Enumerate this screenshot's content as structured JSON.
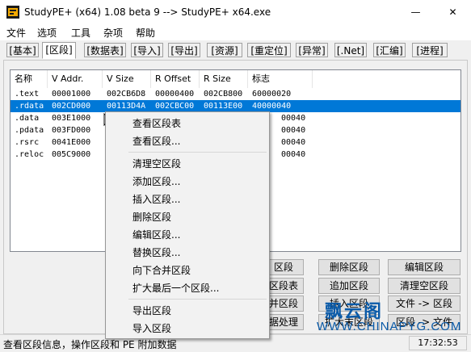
{
  "window": {
    "title": "StudyPE+ (x64) 1.08 beta 9  --> StudyPE+ x64.exe",
    "minimize": "—",
    "close": "✕"
  },
  "menu": [
    "文件",
    "选项",
    "工具",
    "杂项",
    "帮助"
  ],
  "tabs": [
    "[基本]",
    "[区段]",
    "[数据表]",
    "[导入]",
    "[导出]",
    "[资源]",
    "[重定位]",
    "[异常]",
    "[.Net]",
    "[汇编]",
    "[进程]"
  ],
  "table": {
    "headers": [
      "名称",
      "V Addr.",
      "V Size",
      "R Offset",
      "R Size",
      "标志"
    ],
    "rows": [
      [
        ".text",
        "00001000",
        "002CB6D8",
        "00000400",
        "002CB800",
        "60000020"
      ],
      [
        ".rdata",
        "002CD000",
        "00113D4A",
        "002CBC00",
        "00113E00",
        "40000040"
      ],
      [
        ".data",
        "003E1000",
        "",
        "",
        "",
        "00040"
      ],
      [
        ".pdata",
        "003FD000",
        "",
        "",
        "",
        "00040"
      ],
      [
        ".rsrc",
        "0041E000",
        "",
        "",
        "",
        "00040"
      ],
      [
        ".reloc",
        "005C9000",
        "",
        "",
        "",
        "00040"
      ]
    ]
  },
  "context_menu": {
    "group1": [
      "查看区段表",
      "查看区段..."
    ],
    "group2": [
      "清理空区段",
      "添加区段...",
      "插入区段...",
      "删除区段",
      "编辑区段...",
      "替换区段...",
      "向下合并区段",
      "扩大最后一个区段..."
    ],
    "group3": [
      "导出区段",
      "导入区段"
    ]
  },
  "buttons": {
    "row1": [
      "区段",
      "删除区段",
      "编辑区段"
    ],
    "row2": [
      "区段表",
      "追加区段",
      "清理空区段"
    ],
    "row3": [
      "并区段",
      "插入区段",
      "文件 -> 区段"
    ],
    "row4": [
      "据处理",
      "扩大末区段",
      "区段 -> 文件"
    ]
  },
  "status": {
    "left": "查看区段信息，操作区段和 PE 附加数据",
    "time": "17:32:53"
  },
  "watermark": {
    "text": "飘云阁",
    "url": "WWW.CHINAPYG.COM"
  }
}
